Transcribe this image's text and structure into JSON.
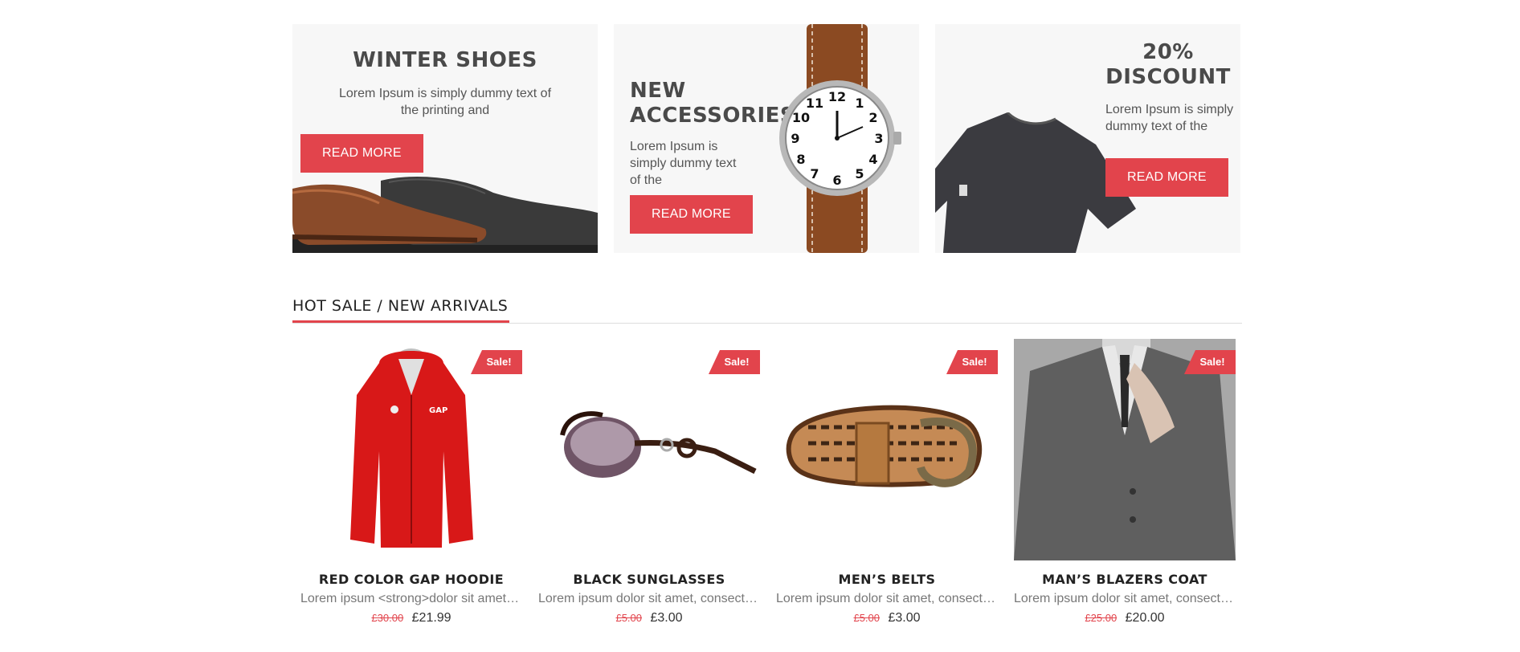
{
  "banners": [
    {
      "title": "WINTER SHOES",
      "text": "Lorem Ipsum is simply dummy text of the printing and",
      "button": "READ MORE",
      "image": "leather-shoes"
    },
    {
      "title_line1": "NEW",
      "title_line2": "ACCESSORIES",
      "text": "Lorem Ipsum is simply dummy text of the",
      "button": "READ MORE",
      "image": "wrist-watch"
    },
    {
      "title_line1": "20%",
      "title_line2": "DISCOUNT",
      "text": "Lorem Ipsum is simply dummy text of the",
      "button": "READ MORE",
      "image": "t-shirt"
    }
  ],
  "section": {
    "title": "HOT SALE / NEW ARRIVALS"
  },
  "sale_badge": "Sale!",
  "products": [
    {
      "name": "RED COLOR GAP HOODIE",
      "desc": "Lorem ipsum <strong>dolor sit amet, consectetur",
      "old_price": "£30.00",
      "price": "£21.99",
      "image": "red-hoodie"
    },
    {
      "name": "BLACK SUNGLASSES",
      "desc": "Lorem ipsum dolor sit amet, consectetur",
      "old_price": "£5.00",
      "price": "£3.00",
      "image": "sunglasses"
    },
    {
      "name": "MEN’S BELTS",
      "desc": "Lorem ipsum dolor sit amet, consectetur",
      "old_price": "£5.00",
      "price": "£3.00",
      "image": "braided-belt"
    },
    {
      "name": "MAN’S BLAZERS COAT",
      "desc": "Lorem ipsum dolor sit amet, consectetur",
      "old_price": "£25.00",
      "price": "£20.00",
      "image": "blazer-coat"
    }
  ],
  "colors": {
    "accent": "#e2444c",
    "banner_bg": "#f7f7f7"
  }
}
